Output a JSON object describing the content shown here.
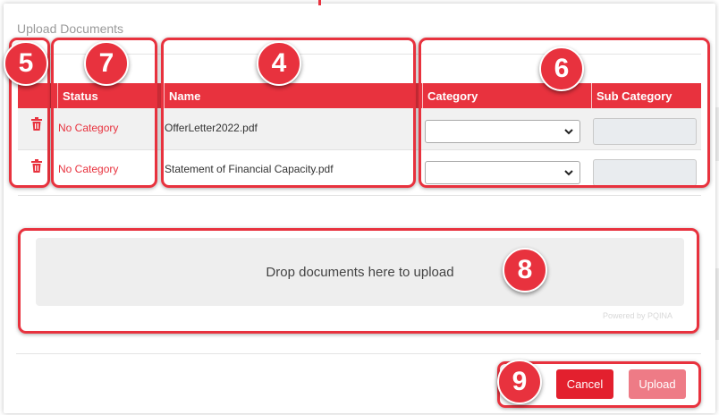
{
  "dialog": {
    "title": "Upload Documents"
  },
  "table": {
    "columns": {
      "status": "Status",
      "name": "Name",
      "category": "Category",
      "sub_category": "Sub Category"
    },
    "rows": [
      {
        "status": "No Category",
        "name": "OfferLetter2022.pdf",
        "category": "",
        "sub_category": ""
      },
      {
        "status": "No Category",
        "name": "Statement of Financial Capacity.pdf",
        "category": "",
        "sub_category": ""
      }
    ]
  },
  "dropzone": {
    "text": "Drop documents here to upload",
    "powered_by": "Powered by PQINA"
  },
  "footer": {
    "cancel_label": "Cancel",
    "upload_label": "Upload"
  },
  "annotations": {
    "badge_delete": "5",
    "badge_status": "7",
    "badge_name": "4",
    "badge_category": "6",
    "badge_dropzone": "8",
    "badge_buttons": "9"
  },
  "colors": {
    "accent": "#e8323e",
    "upload_disabled": "#ee7b86",
    "header_text": "#ffffff"
  },
  "icons": {
    "delete": "trash-icon",
    "select": "chevron-down-icon"
  }
}
